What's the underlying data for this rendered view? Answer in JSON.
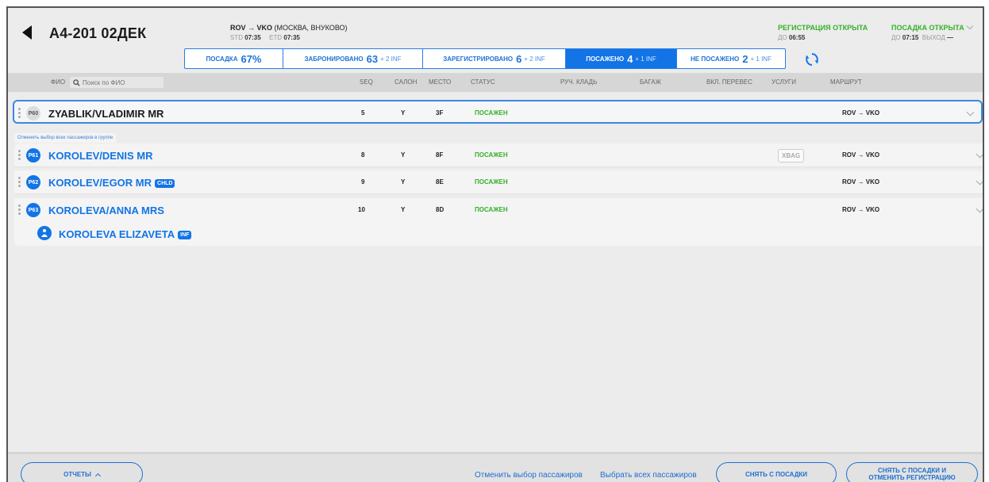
{
  "header": {
    "flight": "А4-201 02ДЕК",
    "route_codes": "ROV → VKO",
    "route_desc": "(МОСКВА, ВНУКОВО)",
    "std_label": "STD",
    "std": "07:35",
    "etd_label": "ETD",
    "etd": "07:35",
    "registration": {
      "title": "РЕГИСТРАЦИЯ ОТКРЫТА",
      "until_label": "ДО",
      "until": "06:55"
    },
    "boarding": {
      "title": "ПОСАДКА ОТКРЫТА",
      "until_label": "ДО",
      "until": "07:15",
      "gate_label": "ВЫХОД",
      "gate": "—"
    }
  },
  "tabs": [
    {
      "label": "ПОСАДКА",
      "count": "67%",
      "inf": ""
    },
    {
      "label": "ЗАБРОНИРОВАНО",
      "count": "63",
      "inf": "+ 2 INF"
    },
    {
      "label": "ЗАРЕГИСТРИРОВАНО",
      "count": "6",
      "inf": "+ 2 INF"
    },
    {
      "label": "ПОСАЖЕНО",
      "count": "4",
      "inf": "+ 1 INF",
      "active": true
    },
    {
      "label": "НЕ ПОСАЖЕНО",
      "count": "2",
      "inf": "+ 1 INF"
    }
  ],
  "columns": {
    "name": "ФИО",
    "search_placeholder": "Поиск по ФИО",
    "seq": "SEQ",
    "cabin": "САЛОН",
    "seat": "МЕСТО",
    "status": "СТАТУС",
    "hand_luggage": "РУЧ. КЛАДЬ",
    "baggage": "БАГАЖ",
    "excess": "ВКЛ. ПЕРЕВЕС",
    "services": "УСЛУГИ",
    "route": "МАРШРУТ"
  },
  "group_note": "Отменить выбор всех пассажиров в группе",
  "passengers": [
    {
      "id": "P60",
      "name": "ZYABLIK/VLADIMIR MR",
      "badge": "",
      "seq": "5",
      "cabin": "Y",
      "seat": "3F",
      "status": "ПОСАЖЕН",
      "service": "",
      "route": "ROV → VKO"
    },
    {
      "id": "P61",
      "name": "KOROLEV/DENIS MR",
      "badge": "",
      "seq": "8",
      "cabin": "Y",
      "seat": "8F",
      "status": "ПОСАЖЕН",
      "service": "XBAG",
      "route": "ROV → VKO"
    },
    {
      "id": "P62",
      "name": "KOROLEV/EGOR MR",
      "badge": "CHLD",
      "seq": "9",
      "cabin": "Y",
      "seat": "8E",
      "status": "ПОСАЖЕН",
      "service": "",
      "route": "ROV → VKO"
    },
    {
      "id": "P63",
      "name": "KOROLEVA/ANNA MRS",
      "badge": "",
      "seq": "10",
      "cabin": "Y",
      "seat": "8D",
      "status": "ПОСАЖЕН",
      "service": "",
      "route": "ROV → VKO"
    }
  ],
  "infant": {
    "name": "KOROLEVA ELIZAVETA",
    "badge": "INF"
  },
  "footer": {
    "reports": "ОТЧЕТЫ",
    "deselect": "Отменить выбор пассажиров",
    "select_all": "Выбрать всех пассажиров",
    "unboard": "СНЯТЬ С ПОСАДКИ",
    "unboard_unreg_1": "СНЯТЬ С ПОСАДКИ И",
    "unboard_unreg_2": "ОТМЕНИТЬ РЕГИСТРАЦИЮ"
  },
  "colors": {
    "accent": "#1274e6",
    "status_green": "#36b02a"
  }
}
